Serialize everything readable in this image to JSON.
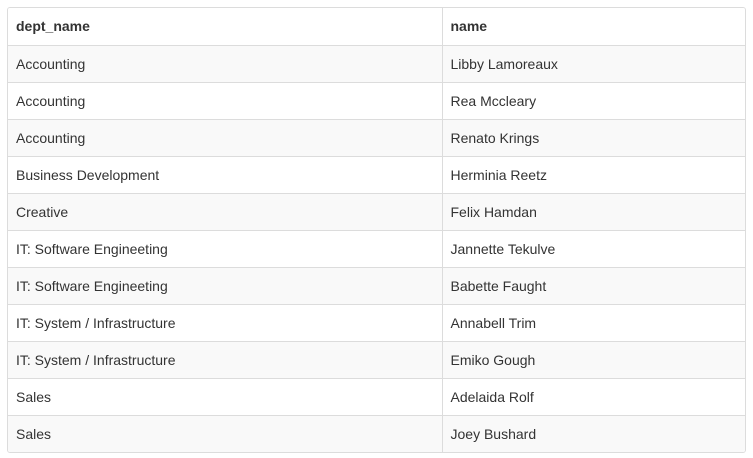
{
  "table": {
    "columns": [
      "dept_name",
      "name"
    ],
    "rows": [
      [
        "Accounting",
        "Libby Lamoreaux"
      ],
      [
        "Accounting",
        "Rea Mccleary"
      ],
      [
        "Accounting",
        "Renato Krings"
      ],
      [
        "Business Development",
        "Herminia Reetz"
      ],
      [
        "Creative",
        "Felix Hamdan"
      ],
      [
        "IT: Software Engineeting",
        "Jannette Tekulve"
      ],
      [
        "IT: Software Engineeting",
        "Babette Faught"
      ],
      [
        "IT: System / Infrastructure",
        "Annabell Trim"
      ],
      [
        "IT: System / Infrastructure",
        "Emiko Gough"
      ],
      [
        "Sales",
        "Adelaida Rolf"
      ],
      [
        "Sales",
        "Joey Bushard"
      ]
    ]
  }
}
